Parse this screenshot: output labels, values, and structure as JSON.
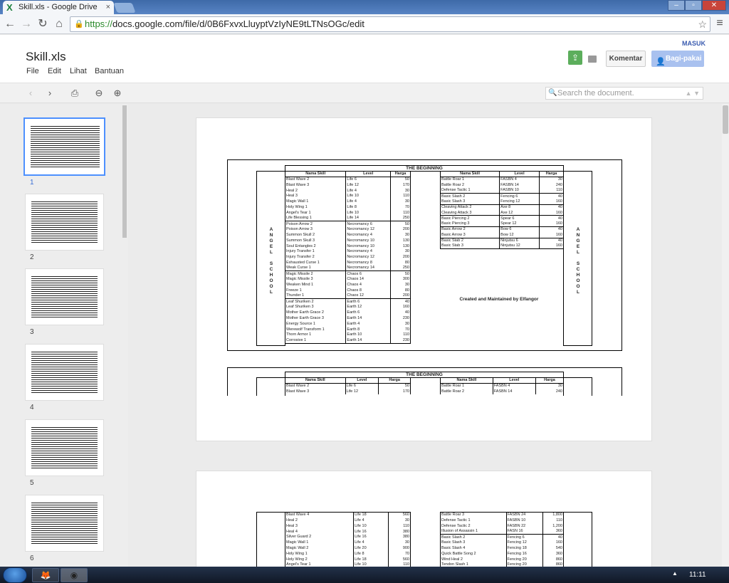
{
  "browser": {
    "tab_title": "Skill.xls - Google Drive",
    "url_https": "https://",
    "url_rest": "docs.google.com/file/d/0B6FxvxLluyptVzIyNE9tLTNsOGc/edit"
  },
  "app": {
    "doc_title": "Skill.xls",
    "menus": [
      "File",
      "Edit",
      "Lihat",
      "Bantuan"
    ],
    "signin": "MASUK",
    "comment_button": "Komentar",
    "share_button": "Bagi-pakai",
    "search_placeholder": "Search the document."
  },
  "thumbnails": [
    "1",
    "2",
    "3",
    "4",
    "5",
    "6"
  ],
  "document": {
    "heading": "THE BEGINNING",
    "columns": [
      "Nama Skill",
      "Level",
      "Harga"
    ],
    "side_label": "A\nN\nG\nE\nL\n\nS\nC\nH\nO\nO\nL",
    "credit": "Created and Maintained by Elfangor",
    "left_table": [
      [
        "Blast Wave 2",
        "Life 6",
        "50"
      ],
      [
        "Blast Wave 3",
        "Life 12",
        "170"
      ],
      [
        "Heal 2",
        "Life 4",
        "30"
      ],
      [
        "Heal 3",
        "Life 10",
        "110"
      ],
      [
        "Magic Wall 1",
        "Life 4",
        "30"
      ],
      [
        "Holy Wing 1",
        "Life 8",
        "70"
      ],
      [
        "Angel's Tear 1",
        "Life 10",
        "110"
      ],
      [
        "Life Blessing 1",
        "Life 14",
        "250"
      ],
      [
        "Poison Arrow 2",
        "Necromancy 6",
        "50"
      ],
      [
        "Poison Arrow 3",
        "Necromancy 12",
        "200"
      ],
      [
        "Summon Skull 2",
        "Necromancy 4",
        "30"
      ],
      [
        "Summon Skull 3",
        "Necromancy 10",
        "130"
      ],
      [
        "Soul Entangles 2",
        "Necromancy 10",
        "130"
      ],
      [
        "Injury Transfer 1",
        "Necromancy 4",
        "30"
      ],
      [
        "Injury Transfer 2",
        "Necromancy 12",
        "200"
      ],
      [
        "Exhausted Curse 1",
        "Necromancy 8",
        "80"
      ],
      [
        "Weak Curse 1",
        "Necromancy 14",
        "250"
      ],
      [
        "Magic Missile 2",
        "Chaos 6",
        "50"
      ],
      [
        "Magic Missile 3",
        "Chaos 14",
        "300"
      ],
      [
        "Weaken Mind 1",
        "Chaos 4",
        "30"
      ],
      [
        "Freeze 1",
        "Chaos 8",
        "80"
      ],
      [
        "Thunder 1",
        "Chaos 12",
        "200"
      ],
      [
        "Leaf Shuriken 2",
        "Earth 6",
        "40"
      ],
      [
        "Leaf Shuriken 3",
        "Earth 12",
        "160"
      ],
      [
        "Mother Earth Grace 2",
        "Earth 6",
        "40"
      ],
      [
        "Mother Earth Grace 3",
        "Earth 14",
        "230"
      ],
      [
        "Energy Source 1",
        "Earth 4",
        "30"
      ],
      [
        "Werewolf Transform 1",
        "Earth 8",
        "70"
      ],
      [
        "Thorn Armor 1",
        "Earth 10",
        "110"
      ],
      [
        "Corrosive 1",
        "Earth 14",
        "230"
      ]
    ],
    "right_table": [
      [
        "Battle Roar 1",
        "FASBN 4",
        "30"
      ],
      [
        "Battle Roar 2",
        "FASBN 14",
        "240"
      ],
      [
        "Defense Tactic 1",
        "FASBN 10",
        "110"
      ],
      [
        "Basic Slash 2",
        "Fencing 6",
        "40"
      ],
      [
        "Basic Slash 3",
        "Fencing 12",
        "160"
      ],
      [
        "Cleaving Attack 2",
        "Axe 8",
        "40"
      ],
      [
        "Cleaving Attack 3",
        "Axe 12",
        "160"
      ],
      [
        "Basic Piercing 2",
        "Spear 6",
        "40"
      ],
      [
        "Basic Piercing 3",
        "Spear 12",
        "160"
      ],
      [
        "Basic Arrow 2",
        "Bow 6",
        "40"
      ],
      [
        "Basic Arrow 3",
        "Bow 12",
        "160"
      ],
      [
        "Basic Stab 2",
        "Ninjutsu 6",
        "40"
      ],
      [
        "Basic Stab 3",
        "Ninjutsu 12",
        "160"
      ]
    ],
    "page2_left": [
      [
        "Blast Wave 2",
        "Life 6",
        "50"
      ],
      [
        "Blast Wave 3",
        "Life 12",
        "170"
      ]
    ],
    "page2_right": [
      [
        "Battle Roar 1",
        "FASBN 4",
        "30"
      ],
      [
        "Battle Roar 2",
        "FASBN 14",
        "240"
      ]
    ],
    "page3_left": [
      [
        "Blast Wave 4",
        "Life 18",
        "560"
      ],
      [
        "Heal 2",
        "Life 4",
        "30"
      ],
      [
        "Heal 3",
        "Life 10",
        "110"
      ],
      [
        "Heal 4",
        "Life 16",
        "380"
      ],
      [
        "Silver Guard 2",
        "Life 16",
        "380"
      ],
      [
        "Magic Wall 1",
        "Life 4",
        "30"
      ],
      [
        "Magic Wall 2",
        "Life 20",
        "900"
      ],
      [
        "Holy Wing 1",
        "Life 8",
        "70"
      ],
      [
        "Holy Wing 2",
        "Life 18",
        "560"
      ],
      [
        "Angel's Tear 1",
        "Life 10",
        "110"
      ]
    ],
    "page3_right": [
      [
        "Battle Roar 3",
        "FASBN 24",
        "1,800"
      ],
      [
        "Defense Tactic 1",
        "FASBN 10",
        "110"
      ],
      [
        "Defense Tactic 2",
        "FASBN 22",
        "1,200"
      ],
      [
        "Illusion of Assassin 1",
        "FASN 16",
        "360"
      ],
      [
        "Basic Slash 2",
        "Fencing 6",
        "40"
      ],
      [
        "Basic Slash 3",
        "Fencing 12",
        "160"
      ],
      [
        "Basic Slash 4",
        "Fencing 18",
        "540"
      ],
      [
        "Quick Battle Song 2",
        "Fencing 16",
        "360"
      ],
      [
        "Wind Heal 2",
        "Fencing 20",
        "860"
      ],
      [
        "Tendon Slash 1",
        "Fencing 20",
        "860"
      ]
    ]
  },
  "taskbar": {
    "clock": "11:11"
  }
}
